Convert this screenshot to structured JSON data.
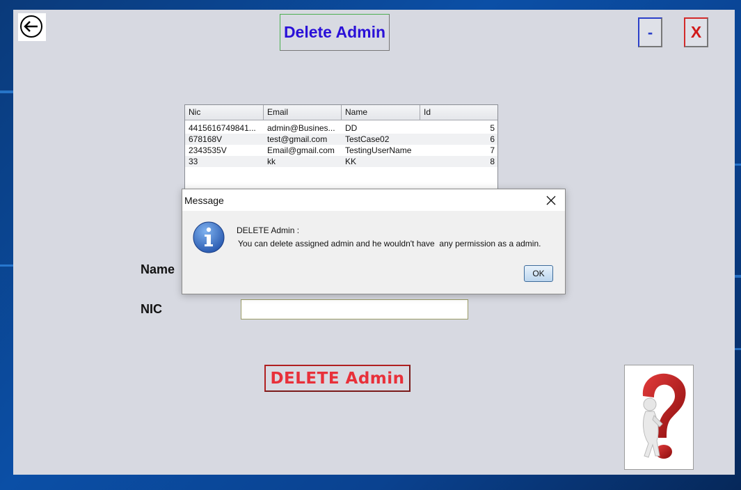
{
  "window": {
    "title": "Delete Admin",
    "minimize_label": "-",
    "close_label": "X"
  },
  "table": {
    "columns": [
      "Nic",
      "Email",
      "Name",
      "Id"
    ],
    "rows": [
      [
        "4415616749841...",
        "admin@Busines...",
        "DD",
        "5"
      ],
      [
        "678168V",
        "test@gmail.com",
        "TestCase02",
        "6"
      ],
      [
        "2343535V",
        "Email@gmail.com",
        "TestingUserName",
        "7"
      ],
      [
        "33",
        "kk",
        "KK",
        "8"
      ]
    ]
  },
  "form": {
    "name_label": "Name",
    "nic_label": "NIC",
    "nic_value": "",
    "delete_button": "DELETE Admin"
  },
  "dialog": {
    "title": "Message",
    "heading": "DELETE Admin :",
    "message": "You can delete assigned admin and he wouldn't have  any permission as a admin.",
    "ok_label": "OK"
  },
  "icons": {
    "back": "back-arrow-icon",
    "info": "info-icon",
    "help": "help-question-icon",
    "dialog_close": "close-icon"
  }
}
